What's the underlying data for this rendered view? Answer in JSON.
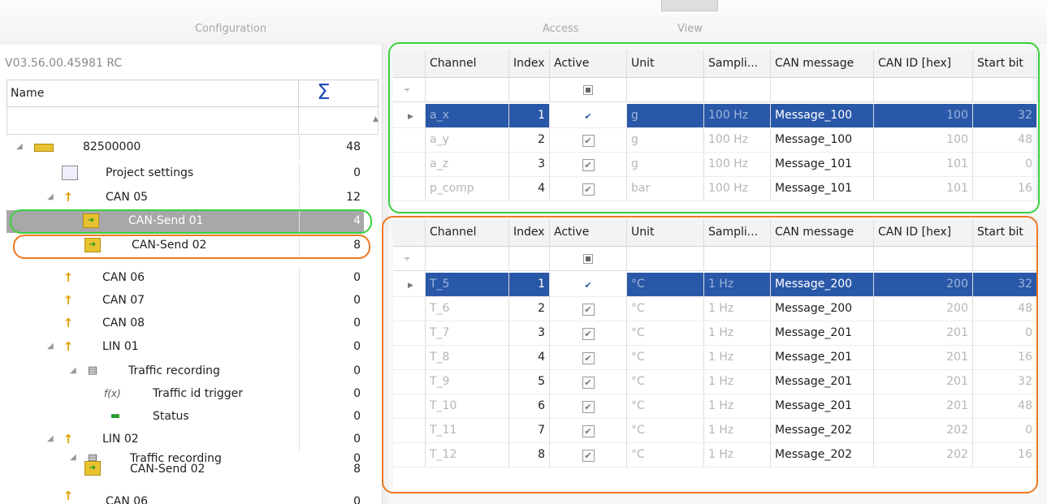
{
  "tabs": {
    "configuration": "Configuration",
    "access": "Access",
    "view": "View"
  },
  "version": "V03.56.00.45981 RC",
  "tree": {
    "header_name": "Name",
    "header_sum": "Σ",
    "rows": [
      {
        "label": "82500000",
        "count": "48"
      },
      {
        "label": "Project settings",
        "count": "0"
      },
      {
        "label": "CAN 05",
        "count": "12"
      },
      {
        "label": "CAN-Send 01",
        "count": "4"
      },
      {
        "label": "CAN-Send 02",
        "count": "8"
      },
      {
        "label": "CAN 06",
        "count": "0"
      },
      {
        "label": "CAN 07",
        "count": "0"
      },
      {
        "label": "CAN 08",
        "count": "0"
      },
      {
        "label": "LIN 01",
        "count": "0"
      },
      {
        "label": "Traffic recording",
        "count": "0"
      },
      {
        "label": "Traffic id trigger",
        "count": "0"
      },
      {
        "label": "Status",
        "count": "0"
      },
      {
        "label": "LIN 02",
        "count": "0"
      },
      {
        "label": "Traffic recording",
        "count": "0"
      },
      {
        "label": "CAN-Send 02",
        "count": "8"
      },
      {
        "label": "CAN 06",
        "count": "0"
      }
    ]
  },
  "columns": [
    "Channel",
    "Index",
    "Active",
    "Unit",
    "Sampli...",
    "CAN message",
    "CAN ID [hex]",
    "Start bit"
  ],
  "grid1": [
    {
      "channel": "a_x",
      "index": "1",
      "unit": "g",
      "rate": "100 Hz",
      "message": "Message_100",
      "canid": "100",
      "startbit": "32"
    },
    {
      "channel": "a_y",
      "index": "2",
      "unit": "g",
      "rate": "100 Hz",
      "message": "Message_100",
      "canid": "100",
      "startbit": "48"
    },
    {
      "channel": "a_z",
      "index": "3",
      "unit": "g",
      "rate": "100 Hz",
      "message": "Message_101",
      "canid": "101",
      "startbit": "0"
    },
    {
      "channel": "p_comp",
      "index": "4",
      "unit": "bar",
      "rate": "100 Hz",
      "message": "Message_101",
      "canid": "101",
      "startbit": "16"
    }
  ],
  "grid2": [
    {
      "channel": "T_5",
      "index": "1",
      "unit": "°C",
      "rate": "1 Hz",
      "message": "Message_200",
      "canid": "200",
      "startbit": "32"
    },
    {
      "channel": "T_6",
      "index": "2",
      "unit": "°C",
      "rate": "1 Hz",
      "message": "Message_200",
      "canid": "200",
      "startbit": "48"
    },
    {
      "channel": "T_7",
      "index": "3",
      "unit": "°C",
      "rate": "1 Hz",
      "message": "Message_201",
      "canid": "201",
      "startbit": "0"
    },
    {
      "channel": "T_8",
      "index": "4",
      "unit": "°C",
      "rate": "1 Hz",
      "message": "Message_201",
      "canid": "201",
      "startbit": "16"
    },
    {
      "channel": "T_9",
      "index": "5",
      "unit": "°C",
      "rate": "1 Hz",
      "message": "Message_201",
      "canid": "201",
      "startbit": "32"
    },
    {
      "channel": "T_10",
      "index": "6",
      "unit": "°C",
      "rate": "1 Hz",
      "message": "Message_201",
      "canid": "201",
      "startbit": "48"
    },
    {
      "channel": "T_11",
      "index": "7",
      "unit": "°C",
      "rate": "1 Hz",
      "message": "Message_202",
      "canid": "202",
      "startbit": "0"
    },
    {
      "channel": "T_12",
      "index": "8",
      "unit": "°C",
      "rate": "1 Hz",
      "message": "Message_202",
      "canid": "202",
      "startbit": "16"
    }
  ],
  "colors": {
    "selection": "#2a58a8",
    "tree_selection": "#a8a8a8",
    "ring_green": "#39d13e",
    "ring_orange": "#ef7822"
  }
}
